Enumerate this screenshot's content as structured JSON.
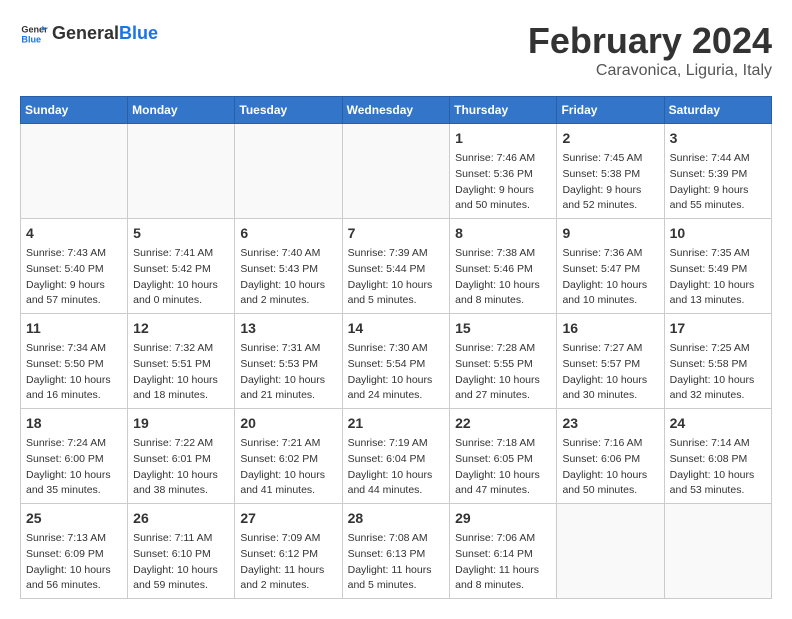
{
  "header": {
    "logo_main": "General",
    "logo_accent": "Blue",
    "month_title": "February 2024",
    "location": "Caravonica, Liguria, Italy"
  },
  "weekdays": [
    "Sunday",
    "Monday",
    "Tuesday",
    "Wednesday",
    "Thursday",
    "Friday",
    "Saturday"
  ],
  "weeks": [
    [
      {
        "day": "",
        "detail": ""
      },
      {
        "day": "",
        "detail": ""
      },
      {
        "day": "",
        "detail": ""
      },
      {
        "day": "",
        "detail": ""
      },
      {
        "day": "1",
        "detail": "Sunrise: 7:46 AM\nSunset: 5:36 PM\nDaylight: 9 hours\nand 50 minutes."
      },
      {
        "day": "2",
        "detail": "Sunrise: 7:45 AM\nSunset: 5:38 PM\nDaylight: 9 hours\nand 52 minutes."
      },
      {
        "day": "3",
        "detail": "Sunrise: 7:44 AM\nSunset: 5:39 PM\nDaylight: 9 hours\nand 55 minutes."
      }
    ],
    [
      {
        "day": "4",
        "detail": "Sunrise: 7:43 AM\nSunset: 5:40 PM\nDaylight: 9 hours\nand 57 minutes."
      },
      {
        "day": "5",
        "detail": "Sunrise: 7:41 AM\nSunset: 5:42 PM\nDaylight: 10 hours\nand 0 minutes."
      },
      {
        "day": "6",
        "detail": "Sunrise: 7:40 AM\nSunset: 5:43 PM\nDaylight: 10 hours\nand 2 minutes."
      },
      {
        "day": "7",
        "detail": "Sunrise: 7:39 AM\nSunset: 5:44 PM\nDaylight: 10 hours\nand 5 minutes."
      },
      {
        "day": "8",
        "detail": "Sunrise: 7:38 AM\nSunset: 5:46 PM\nDaylight: 10 hours\nand 8 minutes."
      },
      {
        "day": "9",
        "detail": "Sunrise: 7:36 AM\nSunset: 5:47 PM\nDaylight: 10 hours\nand 10 minutes."
      },
      {
        "day": "10",
        "detail": "Sunrise: 7:35 AM\nSunset: 5:49 PM\nDaylight: 10 hours\nand 13 minutes."
      }
    ],
    [
      {
        "day": "11",
        "detail": "Sunrise: 7:34 AM\nSunset: 5:50 PM\nDaylight: 10 hours\nand 16 minutes."
      },
      {
        "day": "12",
        "detail": "Sunrise: 7:32 AM\nSunset: 5:51 PM\nDaylight: 10 hours\nand 18 minutes."
      },
      {
        "day": "13",
        "detail": "Sunrise: 7:31 AM\nSunset: 5:53 PM\nDaylight: 10 hours\nand 21 minutes."
      },
      {
        "day": "14",
        "detail": "Sunrise: 7:30 AM\nSunset: 5:54 PM\nDaylight: 10 hours\nand 24 minutes."
      },
      {
        "day": "15",
        "detail": "Sunrise: 7:28 AM\nSunset: 5:55 PM\nDaylight: 10 hours\nand 27 minutes."
      },
      {
        "day": "16",
        "detail": "Sunrise: 7:27 AM\nSunset: 5:57 PM\nDaylight: 10 hours\nand 30 minutes."
      },
      {
        "day": "17",
        "detail": "Sunrise: 7:25 AM\nSunset: 5:58 PM\nDaylight: 10 hours\nand 32 minutes."
      }
    ],
    [
      {
        "day": "18",
        "detail": "Sunrise: 7:24 AM\nSunset: 6:00 PM\nDaylight: 10 hours\nand 35 minutes."
      },
      {
        "day": "19",
        "detail": "Sunrise: 7:22 AM\nSunset: 6:01 PM\nDaylight: 10 hours\nand 38 minutes."
      },
      {
        "day": "20",
        "detail": "Sunrise: 7:21 AM\nSunset: 6:02 PM\nDaylight: 10 hours\nand 41 minutes."
      },
      {
        "day": "21",
        "detail": "Sunrise: 7:19 AM\nSunset: 6:04 PM\nDaylight: 10 hours\nand 44 minutes."
      },
      {
        "day": "22",
        "detail": "Sunrise: 7:18 AM\nSunset: 6:05 PM\nDaylight: 10 hours\nand 47 minutes."
      },
      {
        "day": "23",
        "detail": "Sunrise: 7:16 AM\nSunset: 6:06 PM\nDaylight: 10 hours\nand 50 minutes."
      },
      {
        "day": "24",
        "detail": "Sunrise: 7:14 AM\nSunset: 6:08 PM\nDaylight: 10 hours\nand 53 minutes."
      }
    ],
    [
      {
        "day": "25",
        "detail": "Sunrise: 7:13 AM\nSunset: 6:09 PM\nDaylight: 10 hours\nand 56 minutes."
      },
      {
        "day": "26",
        "detail": "Sunrise: 7:11 AM\nSunset: 6:10 PM\nDaylight: 10 hours\nand 59 minutes."
      },
      {
        "day": "27",
        "detail": "Sunrise: 7:09 AM\nSunset: 6:12 PM\nDaylight: 11 hours\nand 2 minutes."
      },
      {
        "day": "28",
        "detail": "Sunrise: 7:08 AM\nSunset: 6:13 PM\nDaylight: 11 hours\nand 5 minutes."
      },
      {
        "day": "29",
        "detail": "Sunrise: 7:06 AM\nSunset: 6:14 PM\nDaylight: 11 hours\nand 8 minutes."
      },
      {
        "day": "",
        "detail": ""
      },
      {
        "day": "",
        "detail": ""
      }
    ]
  ]
}
